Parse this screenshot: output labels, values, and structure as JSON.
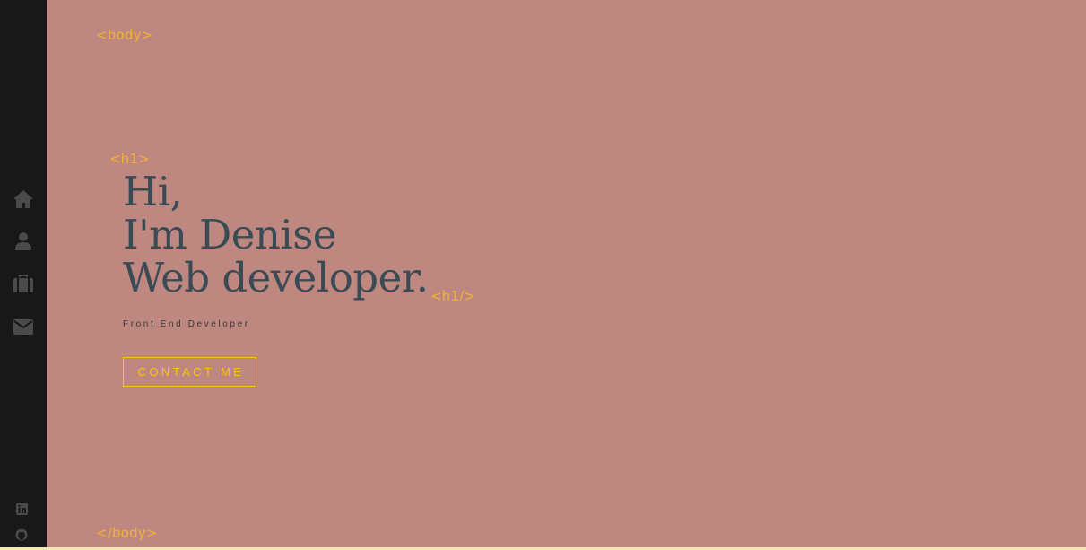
{
  "tags": {
    "body_open": "<body>",
    "h1_open": "<h1>",
    "h1_close": "<h1/>",
    "body_close": "</body>"
  },
  "hero": {
    "line1": "Hi,",
    "line2": "I'm Denise",
    "line3": "Web developer."
  },
  "subtitle": "Front End Developer",
  "contact_button": "CONTACT ME",
  "sidebar": {
    "nav": [
      {
        "icon": "home-icon"
      },
      {
        "icon": "user-icon"
      },
      {
        "icon": "briefcase-icon"
      },
      {
        "icon": "envelope-icon"
      }
    ],
    "social": [
      {
        "icon": "linkedin-icon"
      },
      {
        "icon": "github-icon"
      }
    ]
  },
  "colors": {
    "background": "#be8880",
    "sidebar": "#181818",
    "tag": "#f2b134",
    "heading": "#3b4b55",
    "accent": "#f5c800",
    "icon": "#4a4a4a"
  }
}
